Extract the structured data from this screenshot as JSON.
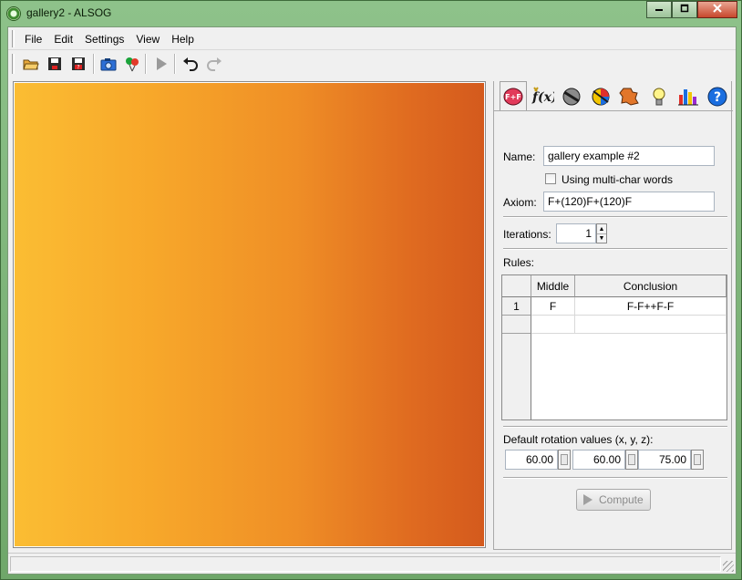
{
  "window": {
    "title": "gallery2 - ALSOG"
  },
  "menu": {
    "items": [
      "File",
      "Edit",
      "Settings",
      "View",
      "Help"
    ]
  },
  "toolbar": {
    "buttons": [
      "open-folder-icon",
      "save-icon",
      "save-as-icon",
      "camera-icon",
      "balloons-icon",
      "play-icon",
      "undo-icon",
      "redo-icon"
    ]
  },
  "panel": {
    "tabs": [
      "rules-tab",
      "functions-tab",
      "geometry-tab",
      "colors-tab",
      "shapes-tab",
      "lighting-tab",
      "statistics-tab",
      "help-tab"
    ],
    "name_label": "Name:",
    "name_value": "gallery example #2",
    "multichar_label": "Using multi-char words",
    "axiom_label": "Axiom:",
    "axiom_value": "F+(120)F+(120)F",
    "iterations_label": "Iterations:",
    "iterations_value": "1",
    "rules_label": "Rules:",
    "rules": {
      "columns": [
        "Middle",
        "Conclusion"
      ],
      "rows": [
        {
          "index": "1",
          "middle": "F",
          "conclusion": "F-F++F-F"
        }
      ]
    },
    "rotation_label": "Default rotation values (x, y, z):",
    "rotation": {
      "x": "60.00",
      "y": "60.00",
      "z": "75.00"
    },
    "compute_label": "Compute"
  },
  "colors": {
    "canvas_left": "#fbbd33",
    "canvas_right": "#d45a1d"
  }
}
